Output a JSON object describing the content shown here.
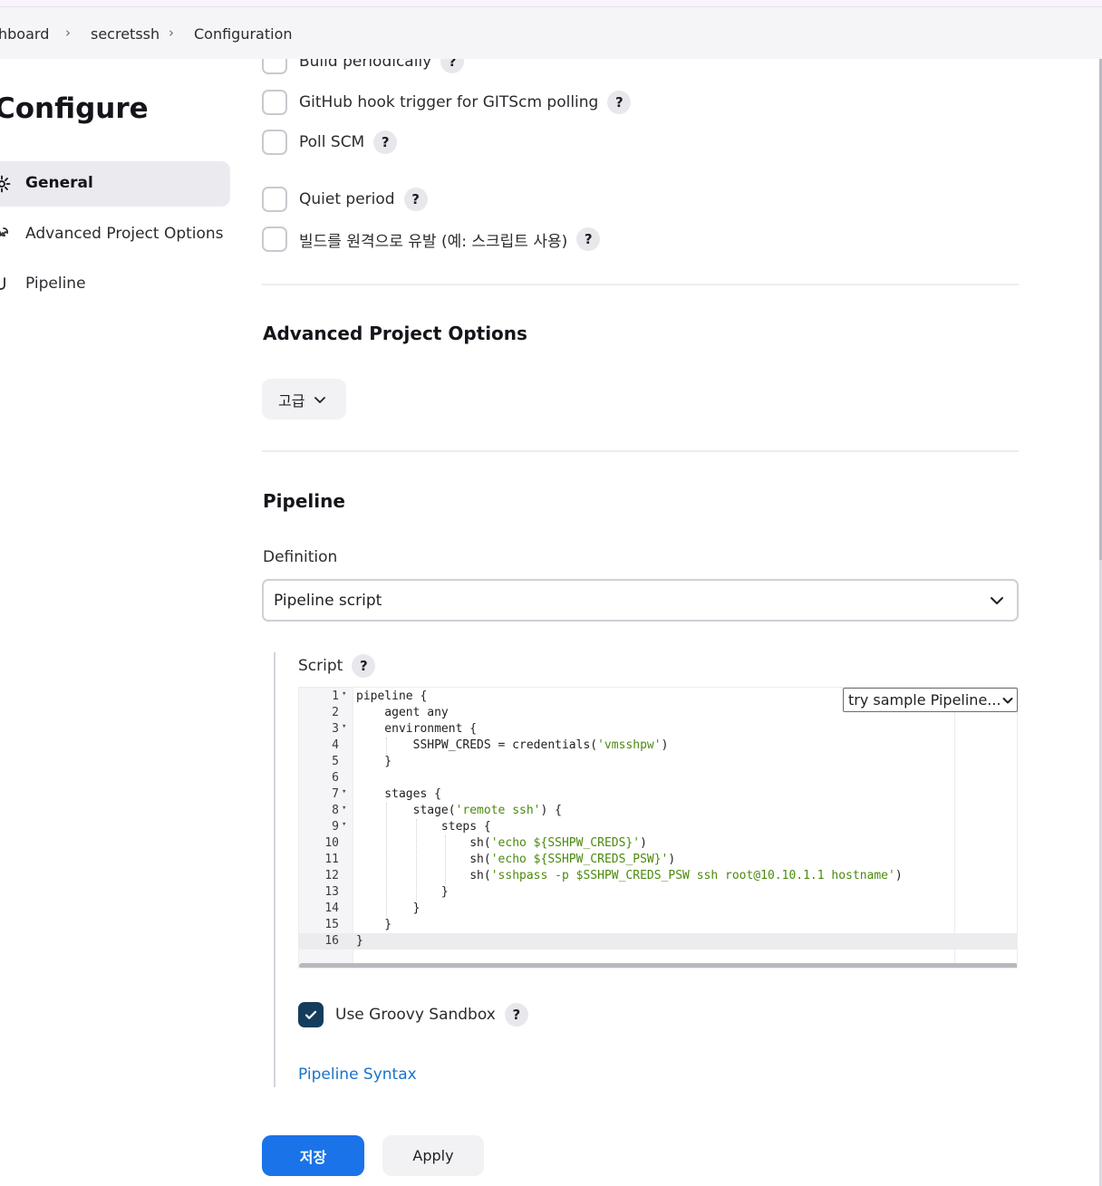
{
  "breadcrumb": {
    "items": [
      "hboard",
      "secretssh",
      "Configuration"
    ]
  },
  "page": {
    "title": "Configure"
  },
  "sidebar": {
    "items": [
      {
        "label": "General",
        "icon": "gear-icon",
        "active": true
      },
      {
        "label": "Advanced Project Options",
        "icon": "wrench-icon",
        "active": false
      },
      {
        "label": "Pipeline",
        "icon": "pipeline-icon",
        "active": false
      }
    ]
  },
  "triggers": {
    "items": [
      {
        "label": "Build periodically",
        "checked": false
      },
      {
        "label": "GitHub hook trigger for GITScm polling",
        "checked": false
      },
      {
        "label": "Poll SCM",
        "checked": false
      },
      {
        "label": "Quiet period",
        "checked": false
      },
      {
        "label": "빌드를 원격으로 유발 (예: 스크립트 사용)",
        "checked": false
      }
    ],
    "help_glyph": "?"
  },
  "advanced": {
    "title": "Advanced Project Options",
    "button_label": "고급"
  },
  "pipeline": {
    "title": "Pipeline",
    "definition_label": "Definition",
    "definition_value": "Pipeline script",
    "script_label": "Script",
    "sample_select_value": "try sample Pipeline...",
    "code": [
      "pipeline {",
      "    agent any",
      "    environment {",
      "        SSHPW_CREDS = credentials('vmsshpw')",
      "    }",
      "",
      "    stages {",
      "        stage('remote ssh') {",
      "            steps {",
      "                sh('echo ${SSHPW_CREDS}')",
      "                sh('echo ${SSHPW_CREDS_PSW}')",
      "                sh('sshpass -p $SSHPW_CREDS_PSW ssh root@10.10.1.1 hostname')",
      "            }",
      "        }",
      "    }",
      "}"
    ],
    "line_numbers": [
      "1",
      "2",
      "3",
      "4",
      "5",
      "6",
      "7",
      "8",
      "9",
      "10",
      "11",
      "12",
      "13",
      "14",
      "15",
      "16"
    ],
    "foldable_lines": [
      1,
      3,
      7,
      8,
      9
    ],
    "current_line": 16,
    "sandbox_label": "Use Groovy Sandbox",
    "sandbox_checked": true,
    "syntax_link": "Pipeline Syntax"
  },
  "actions": {
    "save_label": "저장",
    "apply_label": "Apply"
  },
  "colors": {
    "accent": "#1a73e8",
    "link": "#1a73c9",
    "checkbox_checked": "#143c5c",
    "code_string": "#4b8a0c"
  }
}
